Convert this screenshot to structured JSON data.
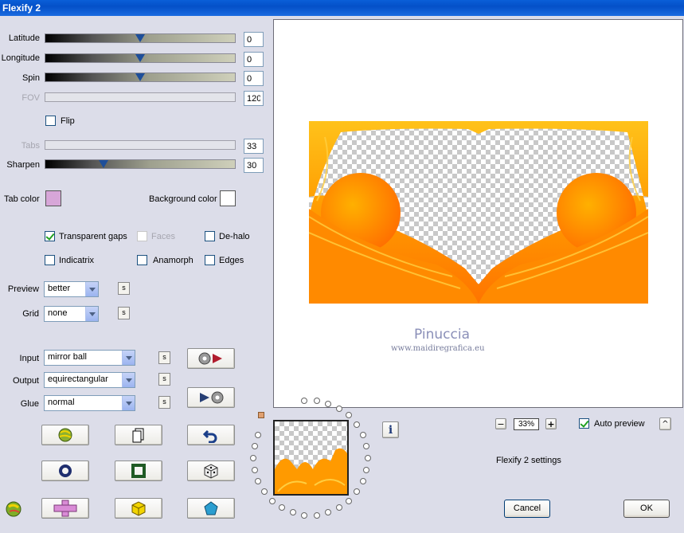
{
  "window": {
    "title": "Flexify 2"
  },
  "sliders": {
    "latitude": {
      "label": "Latitude",
      "value": "0",
      "level": 0.5
    },
    "longitude": {
      "label": "Longitude",
      "value": "0",
      "level": 0.5
    },
    "spin": {
      "label": "Spin",
      "value": "0",
      "level": 0.5
    },
    "fov": {
      "label": "FOV",
      "value": "120"
    },
    "tabs": {
      "label": "Tabs",
      "value": "33"
    },
    "sharpen": {
      "label": "Sharpen",
      "value": "30",
      "level": 0.3
    }
  },
  "flip": {
    "label": "Flip",
    "checked": false
  },
  "colors": {
    "tab_label": "Tab color",
    "tab_value": "#d7a6d8",
    "bg_label": "Background color",
    "bg_value": "#ffffff"
  },
  "options": {
    "transparent_gaps": "Transparent gaps",
    "faces": "Faces",
    "de_halo": "De-halo",
    "indicatrix": "Indicatrix",
    "anamorph": "Anamorph",
    "edges": "Edges"
  },
  "preview_mode": {
    "label": "Preview",
    "value": "better"
  },
  "grid": {
    "label": "Grid",
    "value": "none"
  },
  "input": {
    "label": "Input",
    "value": "mirror ball"
  },
  "output": {
    "label": "Output",
    "value": "equirectangular"
  },
  "glue": {
    "label": "Glue",
    "value": "normal"
  },
  "s_label": "s",
  "watermark": {
    "name": "Pinuccia",
    "url": "www.maidiregrafica.eu"
  },
  "zoom": {
    "minus": "−",
    "value": "33%",
    "plus": "+"
  },
  "auto_preview": {
    "label": "Auto preview",
    "checked": true
  },
  "caret": "^",
  "info_glyph": "i",
  "settings_text": "Flexify 2 settings",
  "cancel": "Cancel",
  "ok": "OK"
}
